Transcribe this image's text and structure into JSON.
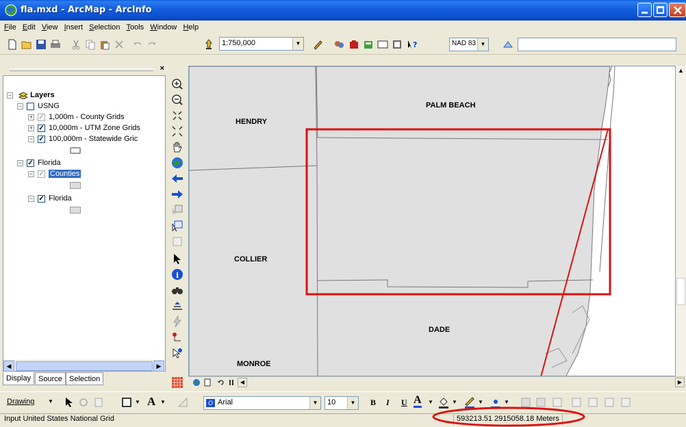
{
  "window": {
    "title": "fla.mxd - ArcMap - ArcInfo"
  },
  "menu": [
    "File",
    "Edit",
    "View",
    "Insert",
    "Selection",
    "Tools",
    "Window",
    "Help"
  ],
  "toolbar": {
    "scale": "1:750,000",
    "projection": "NAD 83",
    "find_value": ""
  },
  "toc": {
    "root": "Layers",
    "groups": [
      {
        "name": "USNG",
        "layers": [
          "1,000m - County Grids",
          "10,000m - UTM Zone Grids",
          "100,000m - Statewide Gric"
        ]
      },
      {
        "name": "Florida",
        "layers": [
          "Counties",
          "Florida"
        ]
      }
    ],
    "tabs": [
      "Display",
      "Source",
      "Selection"
    ]
  },
  "map": {
    "labels": [
      "PALM BEACH",
      "HENDRY",
      "COLLIER",
      "DADE",
      "MONROE"
    ],
    "annotation_color": "#dd1111"
  },
  "drawing": {
    "menu": "Drawing",
    "font": "Arial",
    "size": "10",
    "bold": "B",
    "italic": "I",
    "underline": "U",
    "font_color": "A"
  },
  "status": {
    "message": "Input United States National Grid",
    "coords": "593213.51  2915058.18 Meters"
  },
  "icons": [
    "new-icon",
    "open-icon",
    "save-icon",
    "print-icon",
    "cut-icon",
    "copy-icon",
    "paste-icon",
    "delete-icon",
    "undo-icon",
    "redo-icon",
    "add-data-icon",
    "editor-icon",
    "arctoolbox-icon",
    "catalog-icon",
    "help-icon",
    "zoom-in-icon",
    "zoom-out-icon",
    "pan-icon",
    "full-extent-icon",
    "identify-icon",
    "find-icon",
    "select-arrow-icon"
  ]
}
